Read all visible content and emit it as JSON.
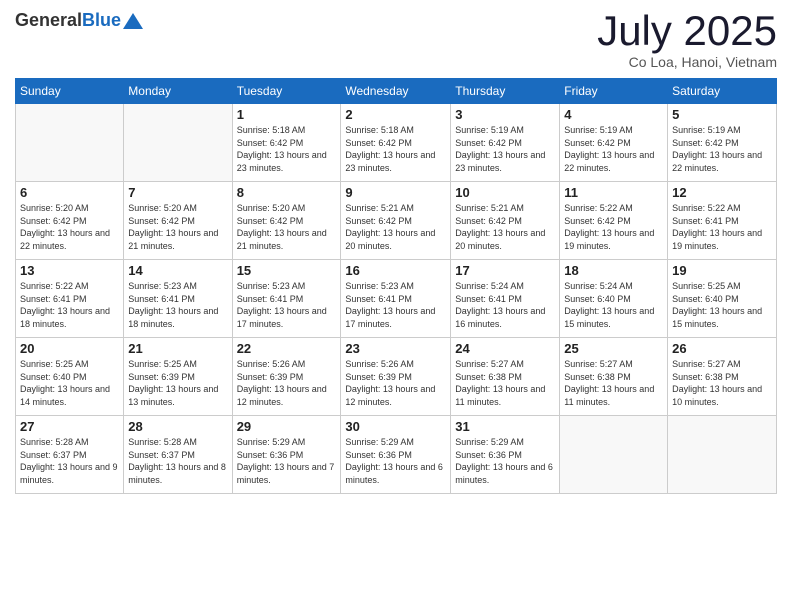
{
  "logo": {
    "general": "General",
    "blue": "Blue"
  },
  "header": {
    "month": "July 2025",
    "location": "Co Loa, Hanoi, Vietnam"
  },
  "days_of_week": [
    "Sunday",
    "Monday",
    "Tuesday",
    "Wednesday",
    "Thursday",
    "Friday",
    "Saturday"
  ],
  "weeks": [
    [
      {
        "day": "",
        "info": ""
      },
      {
        "day": "",
        "info": ""
      },
      {
        "day": "1",
        "info": "Sunrise: 5:18 AM\nSunset: 6:42 PM\nDaylight: 13 hours and 23 minutes."
      },
      {
        "day": "2",
        "info": "Sunrise: 5:18 AM\nSunset: 6:42 PM\nDaylight: 13 hours and 23 minutes."
      },
      {
        "day": "3",
        "info": "Sunrise: 5:19 AM\nSunset: 6:42 PM\nDaylight: 13 hours and 23 minutes."
      },
      {
        "day": "4",
        "info": "Sunrise: 5:19 AM\nSunset: 6:42 PM\nDaylight: 13 hours and 22 minutes."
      },
      {
        "day": "5",
        "info": "Sunrise: 5:19 AM\nSunset: 6:42 PM\nDaylight: 13 hours and 22 minutes."
      }
    ],
    [
      {
        "day": "6",
        "info": "Sunrise: 5:20 AM\nSunset: 6:42 PM\nDaylight: 13 hours and 22 minutes."
      },
      {
        "day": "7",
        "info": "Sunrise: 5:20 AM\nSunset: 6:42 PM\nDaylight: 13 hours and 21 minutes."
      },
      {
        "day": "8",
        "info": "Sunrise: 5:20 AM\nSunset: 6:42 PM\nDaylight: 13 hours and 21 minutes."
      },
      {
        "day": "9",
        "info": "Sunrise: 5:21 AM\nSunset: 6:42 PM\nDaylight: 13 hours and 20 minutes."
      },
      {
        "day": "10",
        "info": "Sunrise: 5:21 AM\nSunset: 6:42 PM\nDaylight: 13 hours and 20 minutes."
      },
      {
        "day": "11",
        "info": "Sunrise: 5:22 AM\nSunset: 6:42 PM\nDaylight: 13 hours and 19 minutes."
      },
      {
        "day": "12",
        "info": "Sunrise: 5:22 AM\nSunset: 6:41 PM\nDaylight: 13 hours and 19 minutes."
      }
    ],
    [
      {
        "day": "13",
        "info": "Sunrise: 5:22 AM\nSunset: 6:41 PM\nDaylight: 13 hours and 18 minutes."
      },
      {
        "day": "14",
        "info": "Sunrise: 5:23 AM\nSunset: 6:41 PM\nDaylight: 13 hours and 18 minutes."
      },
      {
        "day": "15",
        "info": "Sunrise: 5:23 AM\nSunset: 6:41 PM\nDaylight: 13 hours and 17 minutes."
      },
      {
        "day": "16",
        "info": "Sunrise: 5:23 AM\nSunset: 6:41 PM\nDaylight: 13 hours and 17 minutes."
      },
      {
        "day": "17",
        "info": "Sunrise: 5:24 AM\nSunset: 6:41 PM\nDaylight: 13 hours and 16 minutes."
      },
      {
        "day": "18",
        "info": "Sunrise: 5:24 AM\nSunset: 6:40 PM\nDaylight: 13 hours and 15 minutes."
      },
      {
        "day": "19",
        "info": "Sunrise: 5:25 AM\nSunset: 6:40 PM\nDaylight: 13 hours and 15 minutes."
      }
    ],
    [
      {
        "day": "20",
        "info": "Sunrise: 5:25 AM\nSunset: 6:40 PM\nDaylight: 13 hours and 14 minutes."
      },
      {
        "day": "21",
        "info": "Sunrise: 5:25 AM\nSunset: 6:39 PM\nDaylight: 13 hours and 13 minutes."
      },
      {
        "day": "22",
        "info": "Sunrise: 5:26 AM\nSunset: 6:39 PM\nDaylight: 13 hours and 12 minutes."
      },
      {
        "day": "23",
        "info": "Sunrise: 5:26 AM\nSunset: 6:39 PM\nDaylight: 13 hours and 12 minutes."
      },
      {
        "day": "24",
        "info": "Sunrise: 5:27 AM\nSunset: 6:38 PM\nDaylight: 13 hours and 11 minutes."
      },
      {
        "day": "25",
        "info": "Sunrise: 5:27 AM\nSunset: 6:38 PM\nDaylight: 13 hours and 11 minutes."
      },
      {
        "day": "26",
        "info": "Sunrise: 5:27 AM\nSunset: 6:38 PM\nDaylight: 13 hours and 10 minutes."
      }
    ],
    [
      {
        "day": "27",
        "info": "Sunrise: 5:28 AM\nSunset: 6:37 PM\nDaylight: 13 hours and 9 minutes."
      },
      {
        "day": "28",
        "info": "Sunrise: 5:28 AM\nSunset: 6:37 PM\nDaylight: 13 hours and 8 minutes."
      },
      {
        "day": "29",
        "info": "Sunrise: 5:29 AM\nSunset: 6:36 PM\nDaylight: 13 hours and 7 minutes."
      },
      {
        "day": "30",
        "info": "Sunrise: 5:29 AM\nSunset: 6:36 PM\nDaylight: 13 hours and 6 minutes."
      },
      {
        "day": "31",
        "info": "Sunrise: 5:29 AM\nSunset: 6:36 PM\nDaylight: 13 hours and 6 minutes."
      },
      {
        "day": "",
        "info": ""
      },
      {
        "day": "",
        "info": ""
      }
    ]
  ]
}
